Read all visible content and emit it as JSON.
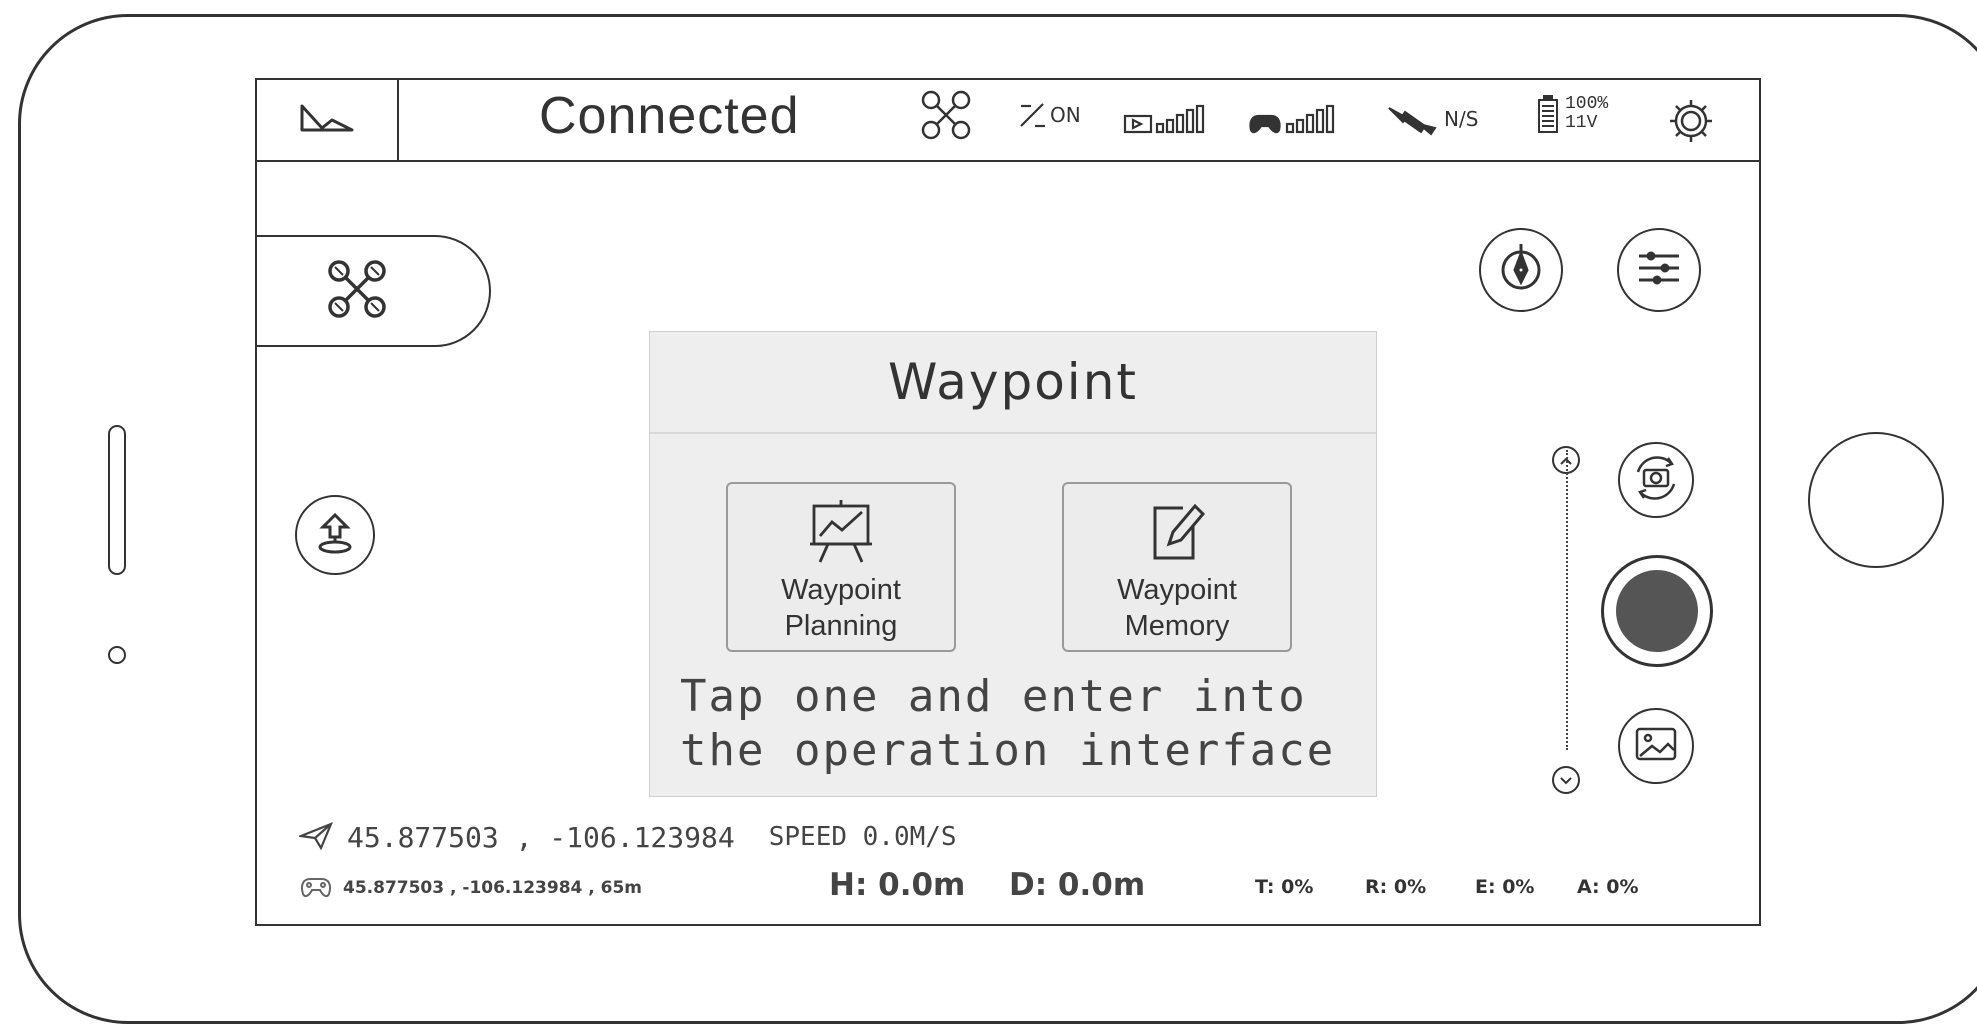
{
  "top_bar": {
    "status": "Connected",
    "gps_toggle_label": "ON",
    "gnss_label": "N/S",
    "battery_percent": "100%",
    "battery_voltage": "11V"
  },
  "dialog": {
    "title": "Waypoint",
    "options": [
      {
        "label": "Waypoint\nPlanning",
        "icon": "chart-easel-icon"
      },
      {
        "label": "Waypoint\nMemory",
        "icon": "edit-note-icon"
      }
    ],
    "hint": "Tap one and enter into\nthe operation  interface"
  },
  "telemetry": {
    "aircraft_coords": "45.877503 , -106.123984",
    "speed": "SPEED 0.0M/S",
    "controller_coords": "45.877503 , -106.123984 , 65m",
    "height": "H: 0.0m",
    "distance": "D: 0.0m",
    "throttle": "T: 0%",
    "rudder": "R: 0%",
    "elevator": "E: 0%",
    "aileron": "A: 0%"
  },
  "colors": {
    "outline": "#333333",
    "dialog_bg": "#eeeeee",
    "record_button": "#555555"
  }
}
